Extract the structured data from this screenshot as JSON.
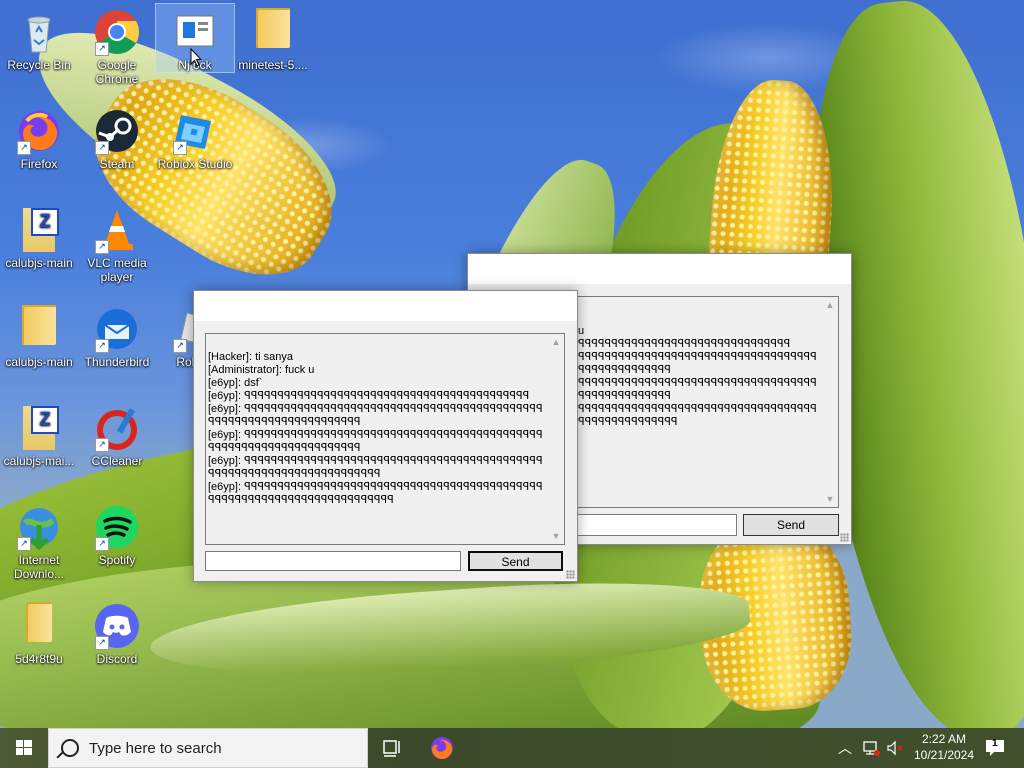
{
  "desktop": {
    "icons": [
      {
        "label": "Recycle Bin"
      },
      {
        "label": "Google Chrome"
      },
      {
        "label": "Nj ock"
      },
      {
        "label": "minetest-5...."
      },
      {
        "label": "Firefox"
      },
      {
        "label": "Steam"
      },
      {
        "label": "Roblox Studio"
      },
      {
        "label": "calubjs-main"
      },
      {
        "label": "VLC media player"
      },
      {
        "label": "calubjs-main"
      },
      {
        "label": "Thunderbird"
      },
      {
        "label": "Roblox"
      },
      {
        "label": "calubjs-mai..."
      },
      {
        "label": "CCleaner"
      },
      {
        "label": "Internet Downlo..."
      },
      {
        "label": "Spotify"
      },
      {
        "label": "5d4r8t9u"
      },
      {
        "label": "Discord"
      }
    ]
  },
  "chat_front": {
    "messages": [
      "[Hacker]: ti sanya",
      "[Administrator]: fuck u",
      "[e6yp]: dsf`",
      "[e6yp]: ꟼꟼꟼꟼꟼꟼꟼꟼꟼꟼꟼꟼꟼꟼꟼꟼꟼꟼꟼꟼꟼꟼꟼꟼꟼꟼꟼꟼꟼꟼꟼꟼꟼꟼꟼꟼꟼꟼꟼꟼꟼꟼꟼ",
      "[e6yp]: ꟼꟼꟼꟼꟼꟼꟼꟼꟼꟼꟼꟼꟼꟼꟼꟼꟼꟼꟼꟼꟼꟼꟼꟼꟼꟼꟼꟼꟼꟼꟼꟼꟼꟼꟼꟼꟼꟼꟼꟼꟼꟼꟼꟼꟼꟼꟼꟼꟼꟼꟼꟼꟼꟼꟼꟼꟼꟼꟼꟼꟼꟼꟼꟼꟼꟼꟼꟼ",
      "[e6yp]: ꟼꟼꟼꟼꟼꟼꟼꟼꟼꟼꟼꟼꟼꟼꟼꟼꟼꟼꟼꟼꟼꟼꟼꟼꟼꟼꟼꟼꟼꟼꟼꟼꟼꟼꟼꟼꟼꟼꟼꟼꟼꟼꟼꟼꟼꟼꟼꟼꟼꟼꟼꟼꟼꟼꟼꟼꟼꟼꟼꟼꟼꟼꟼꟼꟼꟼꟼꟼ",
      "[e6yp]: ꟼꟼꟼꟼꟼꟼꟼꟼꟼꟼꟼꟼꟼꟼꟼꟼꟼꟼꟼꟼꟼꟼꟼꟼꟼꟼꟼꟼꟼꟼꟼꟼꟼꟼꟼꟼꟼꟼꟼꟼꟼꟼꟼꟼꟼꟼꟼꟼꟼꟼꟼꟼꟼꟼꟼꟼꟼꟼꟼꟼꟼꟼꟼꟼꟼꟼꟼꟼꟼꟼꟼ",
      "[e6yp]: ꟼꟼꟼꟼꟼꟼꟼꟼꟼꟼꟼꟼꟼꟼꟼꟼꟼꟼꟼꟼꟼꟼꟼꟼꟼꟼꟼꟼꟼꟼꟼꟼꟼꟼꟼꟼꟼꟼꟼꟼꟼꟼꟼꟼꟼꟼꟼꟼꟼꟼꟼꟼꟼꟼꟼꟼꟼꟼꟼꟼꟼꟼꟼꟼꟼꟼꟼꟼꟼꟼꟼꟼꟼ"
    ],
    "input_value": "",
    "send_label": "Send"
  },
  "chat_back": {
    "messages": [
      "u",
      "ꟼꟼꟼꟼꟼꟼꟼꟼꟼꟼꟼꟼꟼꟼꟼꟼꟼꟼꟼꟼꟼꟼꟼꟼꟼꟼꟼꟼꟼꟼꟼꟼ",
      "ꟼꟼꟼꟼꟼꟼꟼꟼꟼꟼꟼꟼꟼꟼꟼꟼꟼꟼꟼꟼꟼꟼꟼꟼꟼꟼꟼꟼꟼꟼꟼꟼꟼꟼꟼꟼꟼꟼꟼꟼꟼꟼꟼꟼꟼꟼꟼꟼꟼꟼ",
      "ꟼꟼꟼꟼꟼꟼꟼꟼꟼꟼꟼꟼꟼꟼꟼꟼꟼꟼꟼꟼꟼꟼꟼꟼꟼꟼꟼꟼꟼꟼꟼꟼꟼꟼꟼꟼꟼꟼꟼꟼꟼꟼꟼꟼꟼꟼꟼꟼꟼꟼ",
      "ꟼꟼꟼꟼꟼꟼꟼꟼꟼꟼꟼꟼꟼꟼꟼꟼꟼꟼꟼꟼꟼꟼꟼꟼꟼꟼꟼꟼꟼꟼꟼꟼꟼꟼꟼꟼꟼꟼꟼꟼꟼꟼꟼꟼꟼꟼꟼꟼꟼꟼꟼ"
    ],
    "send_label": "Send"
  },
  "taskbar": {
    "search_placeholder": "Type here to search",
    "clock_time": "2:22 AM",
    "clock_date": "10/21/2024",
    "notification_count": "1"
  }
}
